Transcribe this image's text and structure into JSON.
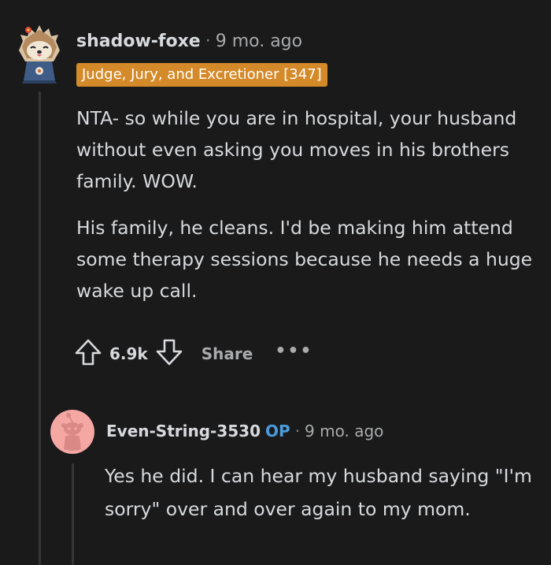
{
  "comment": {
    "author": "shadow-foxe",
    "separator": "·",
    "time": "9 mo. ago",
    "flair": "Judge, Jury, and Excretioner [347]",
    "paragraphs": [
      "NTA- so while you are in hospital, your husband without even asking you moves in his brothers family. WOW.",
      "His family, he cleans. I'd be making him attend some therapy sessions because he needs a huge wake up call."
    ],
    "vote_count": "6.9k",
    "share_label": "Share",
    "more_label": "•••",
    "avatar_icon": "hedgehog-avatar-icon"
  },
  "reply": {
    "author": "Even-String-3530",
    "op_badge": "OP",
    "separator": "·",
    "time": "9 mo. ago",
    "text": "Yes he did. I can hear my husband saying \"I'm sorry\" over and over again to my mom.",
    "avatar_icon": "default-snoo-avatar-icon"
  },
  "colors": {
    "background": "#1a1a1b",
    "flair_bg": "#d58a2a",
    "op_badge": "#4a9bdc",
    "avatar2_bg": "#f4a7a3"
  }
}
